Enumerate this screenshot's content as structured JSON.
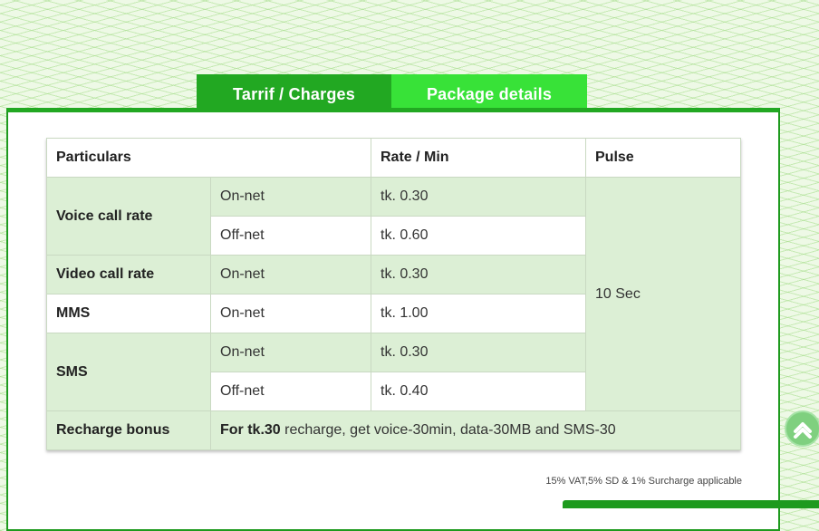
{
  "tabs": [
    {
      "label": "Tarrif / Charges"
    },
    {
      "label": "Package details"
    }
  ],
  "table": {
    "headers": [
      "Particulars",
      "Rate / Min",
      "Pulse"
    ],
    "voice": {
      "label": "Voice call rate",
      "rows": [
        {
          "type": "On-net",
          "rate": "tk. 0.30"
        },
        {
          "type": "Off-net",
          "rate": "tk. 0.60"
        }
      ]
    },
    "video": {
      "label": "Video call rate",
      "type": "On-net",
      "rate": "tk. 0.30"
    },
    "mms": {
      "label": "MMS",
      "type": "On-net",
      "rate": "tk. 1.00"
    },
    "sms": {
      "label": "SMS",
      "rows": [
        {
          "type": "On-net",
          "rate": "tk. 0.30"
        },
        {
          "type": "Off-net",
          "rate": "tk. 0.40"
        }
      ]
    },
    "pulse": "10 Sec",
    "recharge": {
      "label": "Recharge bonus",
      "bold_part": "For tk.30",
      "rest": " recharge, get voice-30min, data-30MB and SMS-30"
    }
  },
  "note": "15% VAT,5% SD & 1% Surcharge applicable",
  "colors": {
    "active_tab": "#22a822",
    "inactive_tab": "#38e238",
    "row_green": "#dcefd5"
  }
}
